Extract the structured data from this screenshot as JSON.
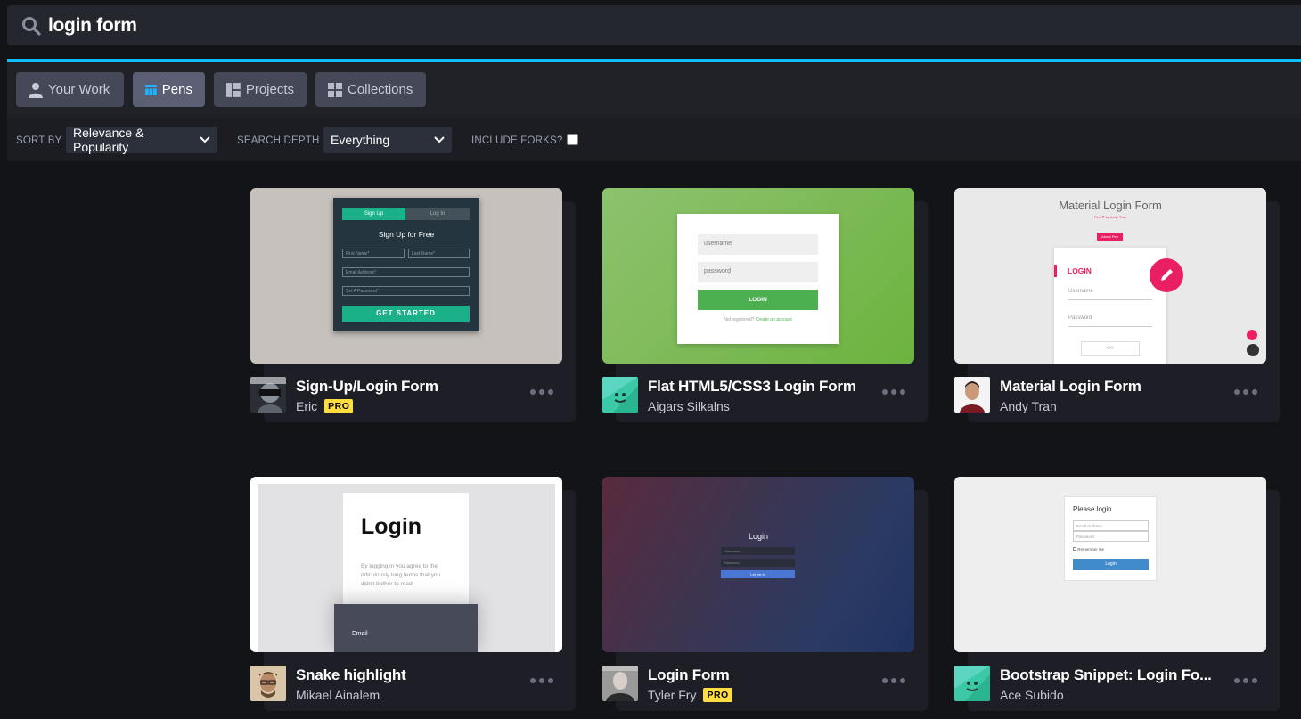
{
  "search": {
    "value": "login form"
  },
  "accent_color": "#0ebeff",
  "tabs": [
    {
      "label": "Your Work",
      "icon": "user-icon"
    },
    {
      "label": "Pens",
      "icon": "pens-grid-icon",
      "active": true
    },
    {
      "label": "Projects",
      "icon": "projects-icon"
    },
    {
      "label": "Collections",
      "icon": "collections-icon"
    }
  ],
  "filters": {
    "sort_by_label": "SORT BY",
    "sort_by_value": "Relevance & Popularity",
    "search_depth_label": "SEARCH DEPTH",
    "search_depth_value": "Everything",
    "include_forks_label": "INCLUDE FORKS?",
    "include_forks_checked": false
  },
  "pens": [
    {
      "title": "Sign-Up/Login Form",
      "author": "Eric",
      "pro": true,
      "pro_label": "PRO",
      "preview": {
        "tab_signup": "Sign Up",
        "tab_login": "Log In",
        "heading": "Sign Up for Free",
        "first_name": "First Name*",
        "last_name": "Last Name*",
        "email": "Email Address*",
        "password": "Set A Password*",
        "button": "GET STARTED"
      }
    },
    {
      "title": "Flat HTML5/CSS3 Login Form",
      "author": "Aigars Silkalns",
      "pro": false,
      "preview": {
        "username": "username",
        "password": "password",
        "button": "LOGIN",
        "note": "Not registered?",
        "link": "Create an account"
      }
    },
    {
      "title": "Material Login Form",
      "author": "Andy Tran",
      "pro": false,
      "preview": {
        "heading": "Material Login Form",
        "byline": "Pen ❤ by Andy Tran",
        "about": "About Pen",
        "login": "LOGIN",
        "username": "Username",
        "password": "Password",
        "go": "GO"
      }
    },
    {
      "title": "Snake highlight",
      "author": "Mikael Ainalem",
      "pro": false,
      "preview": {
        "heading": "Login",
        "body": "By logging in you agree to the ridiculously long terms that you didn't bother to read",
        "email": "Email"
      }
    },
    {
      "title": "Login Form",
      "author": "Tyler Fry",
      "pro": true,
      "pro_label": "PRO",
      "preview": {
        "heading": "Login",
        "username": "Username",
        "password": "Password",
        "button": "Let me in"
      }
    },
    {
      "title": "Bootstrap Snippet: Login Fo...",
      "author": "Ace Subido",
      "pro": false,
      "preview": {
        "heading": "Please login",
        "email": "Email Address",
        "password": "Password",
        "remember": "Remember me",
        "button": "Login"
      }
    }
  ]
}
